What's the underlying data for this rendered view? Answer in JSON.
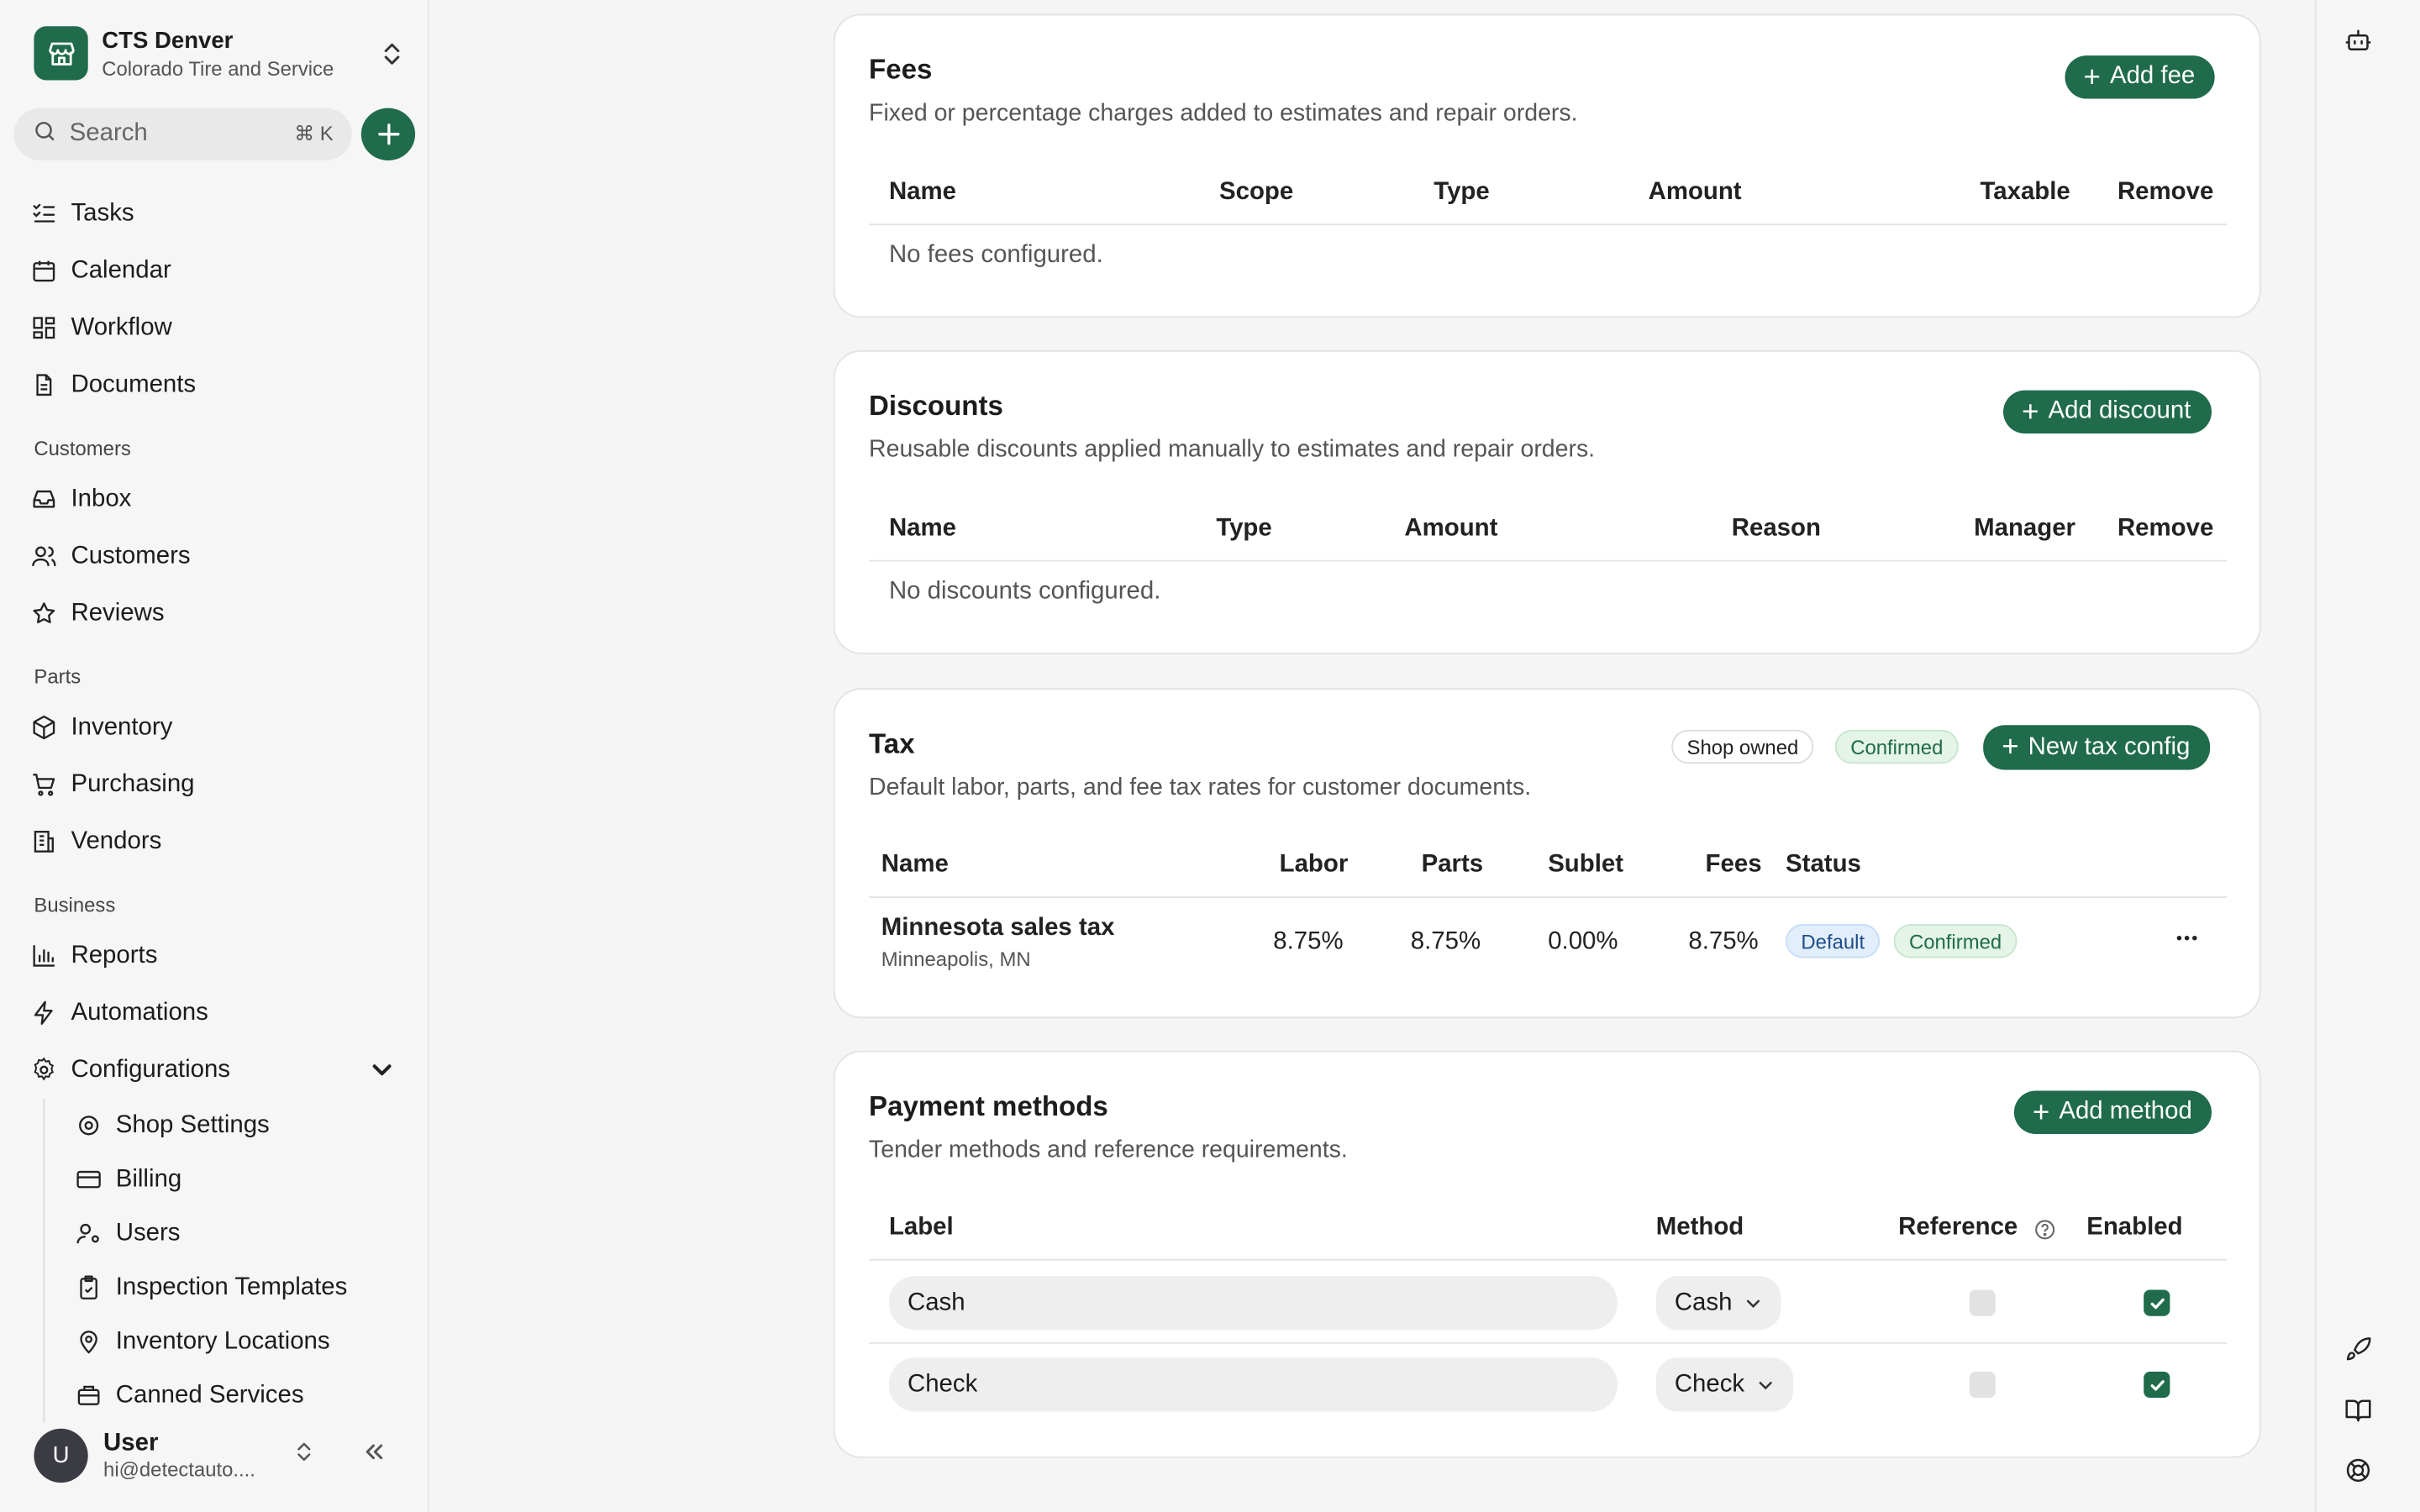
{
  "org": {
    "name": "CTS Denver",
    "subtitle": "Colorado Tire and Service"
  },
  "search": {
    "label": "Search",
    "shortcut": "⌘ K"
  },
  "nav": {
    "tasks": "Tasks",
    "calendar": "Calendar",
    "workflow": "Workflow",
    "documents": "Documents",
    "section_customers": "Customers",
    "inbox": "Inbox",
    "customers": "Customers",
    "reviews": "Reviews",
    "section_parts": "Parts",
    "inventory": "Inventory",
    "purchasing": "Purchasing",
    "vendors": "Vendors",
    "section_business": "Business",
    "reports": "Reports",
    "automations": "Automations",
    "configurations": "Configurations",
    "shop_settings": "Shop Settings",
    "billing": "Billing",
    "users": "Users",
    "inspection_templates": "Inspection Templates",
    "inventory_locations": "Inventory Locations",
    "canned_services": "Canned Services"
  },
  "user": {
    "initial": "U",
    "name": "User",
    "email": "hi@detectauto...."
  },
  "fees": {
    "title": "Fees",
    "description": "Fixed or percentage charges added to estimates and repair orders.",
    "add_label": "Add fee",
    "columns": [
      "Name",
      "Scope",
      "Type",
      "Amount",
      "Taxable",
      "Remove"
    ],
    "empty": "No fees configured."
  },
  "discounts": {
    "title": "Discounts",
    "description": "Reusable discounts applied manually to estimates and repair orders.",
    "add_label": "Add discount",
    "columns": [
      "Name",
      "Type",
      "Amount",
      "Reason",
      "Manager",
      "Remove"
    ],
    "empty": "No discounts configured."
  },
  "tax": {
    "title": "Tax",
    "description": "Default labor, parts, and fee tax rates for customer documents.",
    "badge_owner": "Shop owned",
    "badge_status": "Confirmed",
    "add_label": "New tax config",
    "columns": [
      "Name",
      "Labor",
      "Parts",
      "Sublet",
      "Fees",
      "Status"
    ],
    "rows": [
      {
        "name": "Minnesota sales tax",
        "location": "Minneapolis, MN",
        "labor": "8.75%",
        "parts": "8.75%",
        "sublet": "0.00%",
        "fees": "8.75%",
        "badge_default": "Default",
        "badge_status": "Confirmed"
      }
    ]
  },
  "payments": {
    "title": "Payment methods",
    "description": "Tender methods and reference requirements.",
    "add_label": "Add method",
    "columns": [
      "Label",
      "Method",
      "Reference",
      "Enabled"
    ],
    "rows": [
      {
        "label": "Cash",
        "method": "Cash",
        "reference": false,
        "enabled": true
      },
      {
        "label": "Check",
        "method": "Check",
        "reference": false,
        "enabled": true
      }
    ]
  },
  "colors": {
    "accent": "#1f6b4b"
  }
}
